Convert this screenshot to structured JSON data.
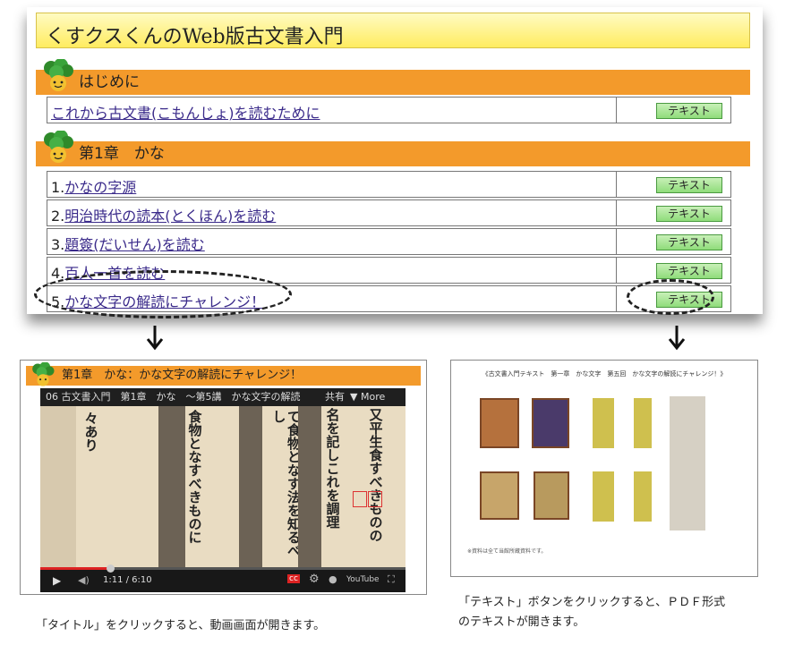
{
  "header": {
    "title": "くすクスくんのWeb版古文書入門"
  },
  "sections": [
    {
      "heading": "はじめに"
    },
    {
      "heading": "第1章　かな"
    }
  ],
  "intro_row": {
    "label": "これから古文書(こもんじょ)を読むために",
    "button": "テキスト"
  },
  "chapter_rows": [
    {
      "num": "1.",
      "label": "かなの字源",
      "button": "テキスト"
    },
    {
      "num": "2.",
      "label": "明治時代の読本(とくほん)を読む",
      "button": "テキスト"
    },
    {
      "num": "3.",
      "label": "題簽(だいせん)を読む",
      "button": "テキスト"
    },
    {
      "num": "4.",
      "label": "百人一首を読む",
      "button": "テキスト"
    },
    {
      "num": "5.",
      "label": "かな文字の解読にチャレンジ！",
      "button": "テキスト"
    }
  ],
  "video_panel": {
    "heading": "第1章　かな：かな文字の解読にチャレンジ！",
    "player_title": "06 古文書入門　第1章　かな　～第5講　かな文字の解読",
    "share": "共有",
    "more_info": "More info",
    "time": "1:11 / 6:10",
    "progress": 0.19,
    "cc_label": "cc",
    "youtube_label": "YouTube",
    "columns": [
      "又平生食すべきものの",
      "名を記しこれを調理",
      "て食物となす法を知るべし",
      "食物となすべきものに",
      "々あり"
    ]
  },
  "pdf_panel": {
    "title": "《古文書入門テキスト　第一章　かな文字　第五回　かな文字の解読にチャレンジ！》",
    "footnote": "※資料は全て当館所蔵資料です。"
  },
  "captions": {
    "video": "「タイトル」をクリックすると、動画画面が開きます。",
    "pdf_line1": "「テキスト」ボタンをクリックすると、ＰＤＦ形式",
    "pdf_line2": "のテキストが開きます。"
  },
  "colors": {
    "title_bg": "#ffec60",
    "section_bg": "#f39a2b",
    "button_bg": "#8fdc7a",
    "link": "#3a2a8a"
  }
}
